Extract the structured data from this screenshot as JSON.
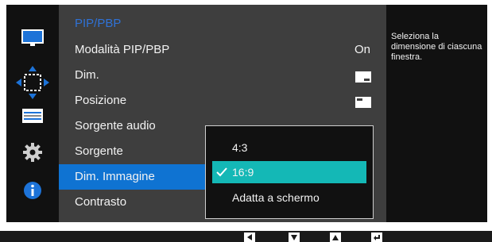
{
  "menu": {
    "title": "PIP/PBP",
    "items": [
      {
        "label": "Modalità PIP/PBP",
        "value": "On"
      },
      {
        "label": "Dim.",
        "value": "",
        "icon": "size-icon"
      },
      {
        "label": "Posizione",
        "value": "",
        "icon": "position-icon"
      },
      {
        "label": "Sorgente audio",
        "value": ""
      },
      {
        "label": "Sorgente",
        "value": ""
      },
      {
        "label": "Dim. Immagine",
        "value": "",
        "selected": true
      },
      {
        "label": "Contrasto",
        "value": ""
      }
    ]
  },
  "dropdown": {
    "options": [
      "4:3",
      "16:9",
      "Adatta a schermo"
    ],
    "selected": "16:9"
  },
  "help": {
    "text": "Seleziona la dimensione di ciascuna finestra."
  },
  "sidebar_icons": [
    "monitor-icon",
    "move-arrows-icon",
    "settings-panel-icon",
    "gear-icon",
    "info-icon"
  ],
  "bottom_keys": [
    "left-key-icon",
    "down-key-icon",
    "up-key-icon",
    "return-key-icon"
  ],
  "colors": {
    "title": "#2f72d6",
    "selected_menu": "#0f73d2",
    "selected_option": "#14b8b6",
    "panel": "#3e3e3e",
    "dark": "#111111"
  }
}
